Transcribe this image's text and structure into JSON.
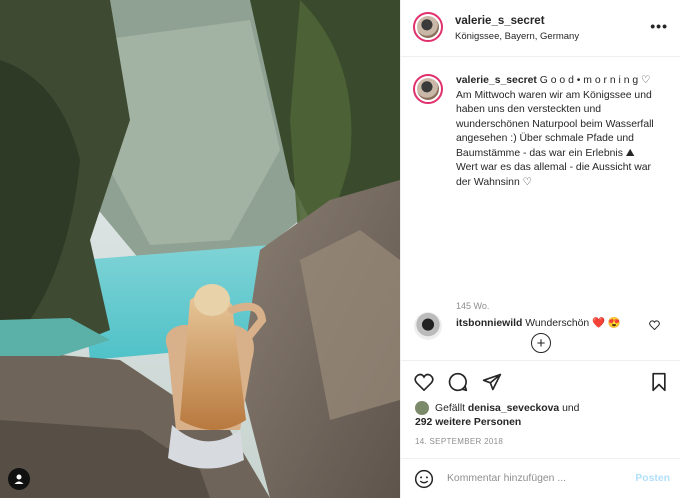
{
  "post": {
    "username": "valerie_s_secret",
    "location": "Königssee, Bayern, Germany",
    "more_label": "•••"
  },
  "caption": {
    "username": "valerie_s_secret",
    "text": "G o o d • m o r n i n g ♡\nAm Mittwoch waren wir am Königssee und haben uns den versteckten und wunderschönen Naturpool beim Wasserfall angesehen :) Über schmale Pfade und Baumstämme - das war ein Erlebnis ⛰\nWert war es das allemal - die Aussicht war der Wahnsinn ♡",
    "time": "145 Wo.",
    "load_more_label": "+"
  },
  "comment": {
    "username": "itsbonniewild",
    "text": "Wunderschön ❤️ 😍"
  },
  "actions": {
    "liked_by_prefix": "Gefällt",
    "liked_by_user": "denisa_seveckova",
    "liked_by_suffix": "und",
    "others": "292 weitere Personen",
    "date": "14. SEPTEMBER 2018"
  },
  "comment_input": {
    "placeholder": "Kommentar hinzufügen ...",
    "post_label": "Posten"
  },
  "colors": {
    "story_ring": "#e1306c",
    "post_button_disabled": "#b2dffc",
    "secondary_text": "#8e8e8e"
  }
}
